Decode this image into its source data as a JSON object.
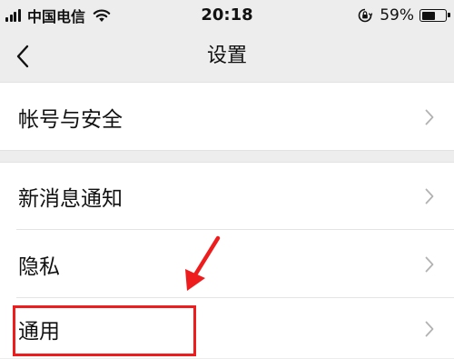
{
  "status_bar": {
    "carrier": "中国电信",
    "time": "20:18",
    "battery_percent": "59%",
    "battery_level": 0.59,
    "icons": [
      "signal-icon",
      "wifi-icon",
      "orientation-lock-icon",
      "battery-icon"
    ]
  },
  "nav": {
    "back_icon": "chevron-left-icon",
    "title": "设置"
  },
  "groups": [
    {
      "items": [
        {
          "label": "帐号与安全"
        }
      ]
    },
    {
      "items": [
        {
          "label": "新消息通知"
        },
        {
          "label": "隐私"
        },
        {
          "label": "通用"
        }
      ]
    }
  ],
  "annotation": {
    "color": "#ee1c1c",
    "arrow_icon": "red-arrow-icon",
    "highlighted_item": "通用"
  },
  "colors": {
    "background": "#ededed",
    "row_background": "#ffffff",
    "chevron": "#b2b2b2"
  }
}
